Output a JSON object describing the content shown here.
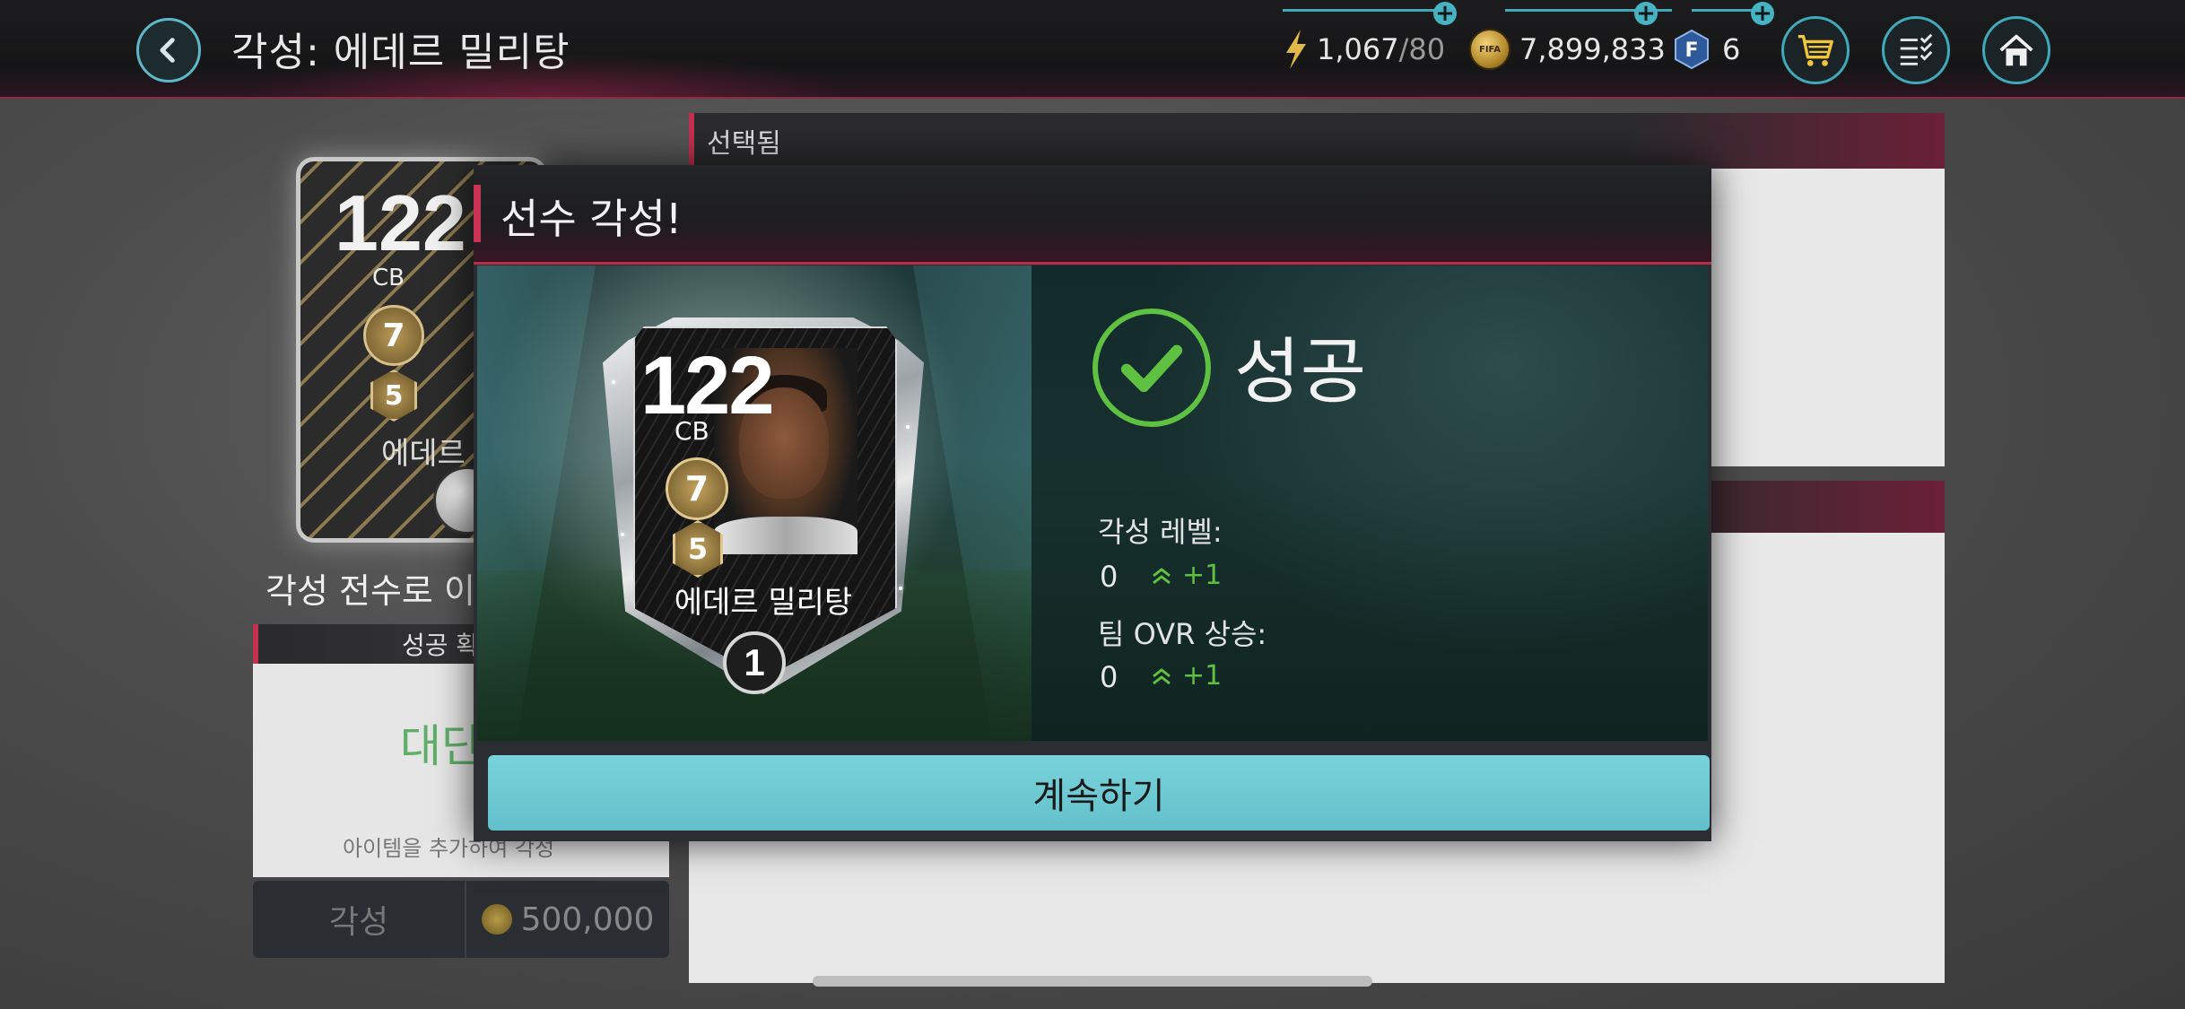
{
  "header": {
    "title": "각성: 에데르 밀리탕",
    "stamina": {
      "current": "1,067",
      "max": "/80"
    },
    "coins": "7,899,833",
    "fifa_points": "6",
    "icons": [
      "back-icon",
      "lightning-icon",
      "coin-icon",
      "fifa-points-icon",
      "cart-icon",
      "checklist-icon",
      "home-icon"
    ]
  },
  "background": {
    "card": {
      "rating": "122",
      "position": "CB",
      "name": "에데르 밀",
      "rank_badge": "7",
      "level_badge": "5"
    },
    "caption": "각성 전수로 이",
    "success_panel": {
      "header": "성공 확",
      "value": "대단",
      "hint": "아이템을 추가하여 각성"
    },
    "awaken_button": "각성",
    "cost": "500,000",
    "selected_header": "선택됨"
  },
  "modal": {
    "title": "선수 각성!",
    "card": {
      "rating": "122",
      "position": "CB",
      "name": "에데르 밀리탕",
      "rank_badge": "7",
      "level_badge": "5",
      "awaken_level": "1"
    },
    "result": "성공",
    "stats": [
      {
        "label": "각성 레벨:",
        "value": "0",
        "increase": "+1"
      },
      {
        "label": "팀 OVR 상승:",
        "value": "0",
        "increase": "+1"
      }
    ],
    "continue_label": "계속하기"
  },
  "colors": {
    "accent_teal": "#63c0ca",
    "accent_red": "#c93355",
    "success_green": "#5fc142"
  }
}
